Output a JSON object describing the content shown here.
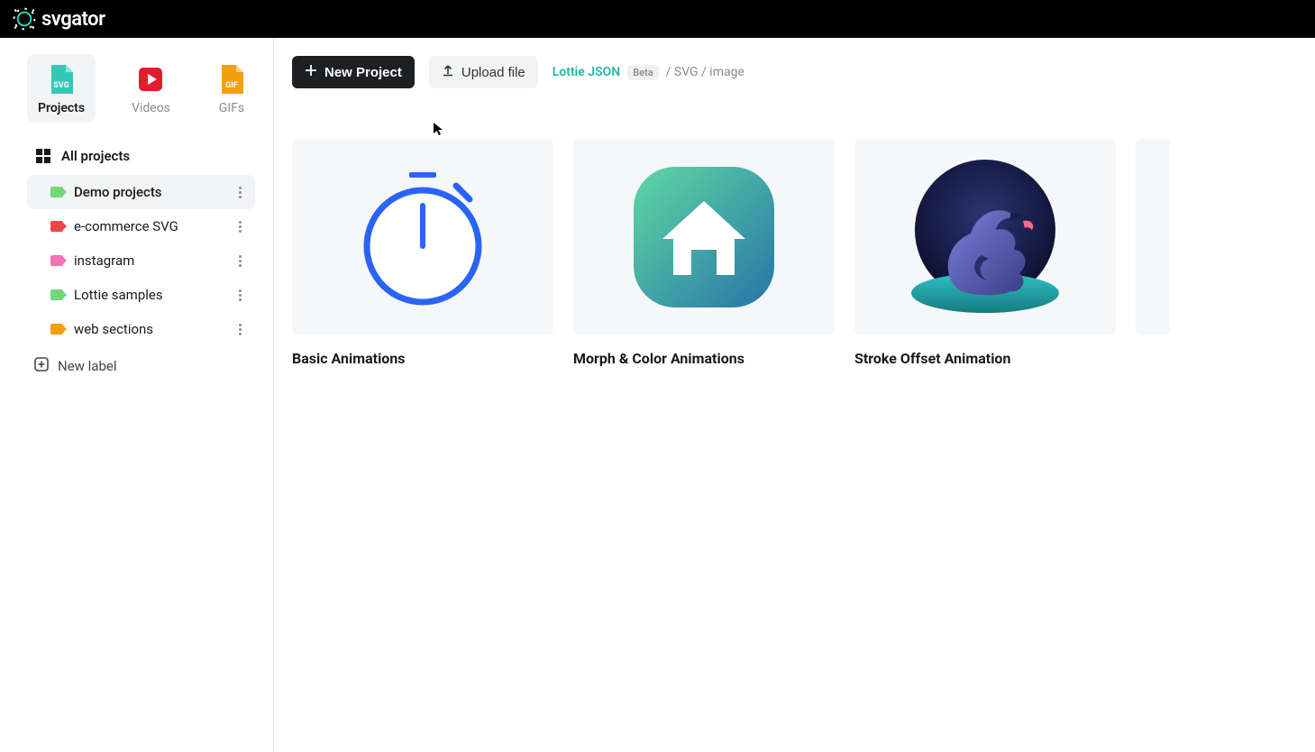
{
  "brand": {
    "name": "svgator"
  },
  "sidebarTabs": {
    "projects": "Projects",
    "videos": "Videos",
    "gifs": "GIFs"
  },
  "nav": {
    "all": "All projects",
    "labels": [
      {
        "name": "Demo projects",
        "color": "#6fd97a",
        "active": true
      },
      {
        "name": "e-commerce SVG",
        "color": "#ef4444",
        "active": false
      },
      {
        "name": "instagram",
        "color": "#f472b6",
        "active": false
      },
      {
        "name": "Lottie samples",
        "color": "#6fd97a",
        "active": false
      },
      {
        "name": "web sections",
        "color": "#f59e0b",
        "active": false
      }
    ],
    "newLabel": "New label"
  },
  "toolbar": {
    "newProject": "New Project",
    "uploadFile": "Upload file",
    "accepts": {
      "lottie": "Lottie JSON",
      "badge": "Beta",
      "rest": "/ SVG / image"
    }
  },
  "projects": [
    {
      "title": "Basic Animations"
    },
    {
      "title": "Morph & Color Animations"
    },
    {
      "title": "Stroke Offset Animation"
    }
  ],
  "icons": {
    "svg_badge": "SVG",
    "gif_badge": "GIF"
  }
}
